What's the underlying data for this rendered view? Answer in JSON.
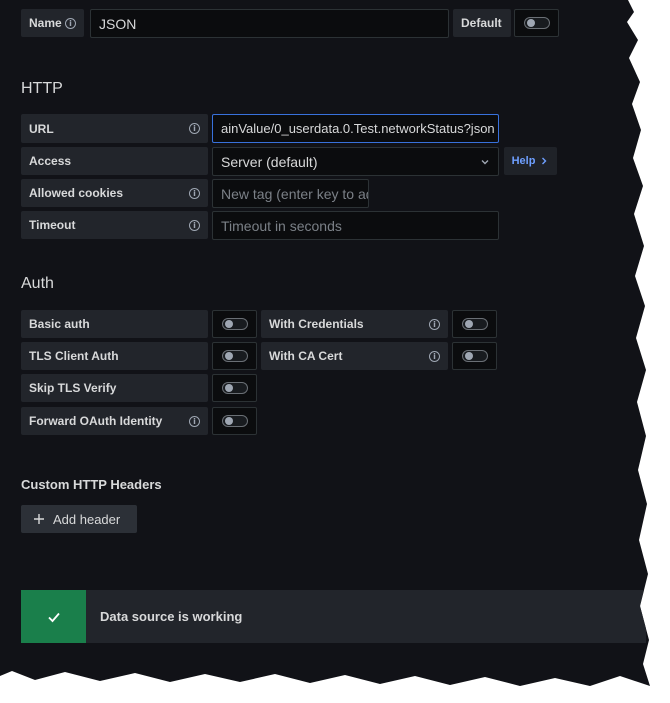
{
  "name_row": {
    "label": "Name",
    "value": "JSON",
    "default_label": "Default"
  },
  "http": {
    "title": "HTTP",
    "url_label": "URL",
    "url_value": "ainValue/0_userdata.0.Test.networkStatus?json",
    "access_label": "Access",
    "access_value": "Server (default)",
    "help_label": "Help",
    "cookies_label": "Allowed cookies",
    "cookies_placeholder": "New tag (enter key to add)",
    "timeout_label": "Timeout",
    "timeout_placeholder": "Timeout in seconds"
  },
  "auth": {
    "title": "Auth",
    "basic_auth": "Basic auth",
    "with_credentials": "With Credentials",
    "tls_client_auth": "TLS Client Auth",
    "with_ca_cert": "With CA Cert",
    "skip_tls_verify": "Skip TLS Verify",
    "forward_oauth": "Forward OAuth Identity"
  },
  "headers": {
    "title": "Custom HTTP Headers",
    "add_label": "Add header"
  },
  "status": {
    "message": "Data source is working",
    "color": "#1a7f4b"
  },
  "icons": {
    "info": "info-icon",
    "chevron_down": "chevron-down-icon",
    "chevron_right": "chevron-right-icon",
    "plus": "plus-icon",
    "check": "check-icon"
  }
}
